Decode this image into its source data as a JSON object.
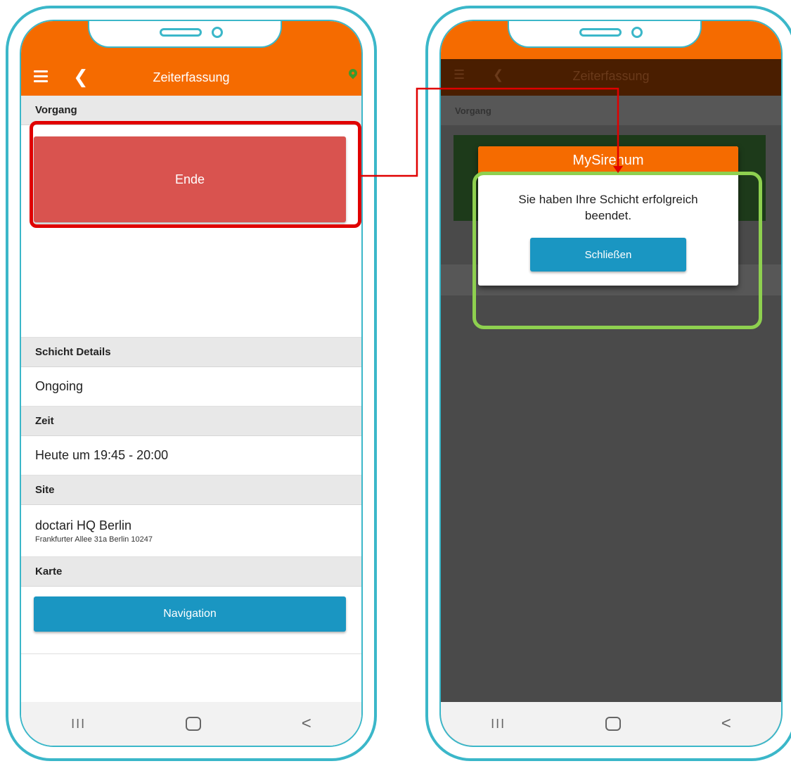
{
  "left_screen": {
    "appbar": {
      "title": "Zeiterfassung"
    },
    "vorgang": {
      "header": "Vorgang",
      "button_label": "Ende"
    },
    "schicht_details": {
      "header": "Schicht Details",
      "value": "Ongoing"
    },
    "zeit": {
      "header": "Zeit",
      "value": "Heute um 19:45 - 20:00"
    },
    "site": {
      "header": "Site",
      "name": "doctari HQ Berlin",
      "address": "Frankfurter Allee 31a Berlin 10247"
    },
    "karte": {
      "header": "Karte",
      "button_label": "Navigation"
    },
    "system_nav": {
      "recent": "III",
      "back": "<"
    }
  },
  "right_screen": {
    "appbar": {
      "title": "Zeiterfassung"
    },
    "vorgang": {
      "header": "Vorgang"
    },
    "dialog": {
      "title": "MySirenum",
      "message": "Sie haben Ihre Schicht erfolgreich beendet.",
      "button_label": "Schließen"
    },
    "system_nav": {
      "recent": "III",
      "back": "<"
    }
  },
  "colors": {
    "brand_orange": "#f56b00",
    "end_red": "#d9534f",
    "action_blue": "#1a96c2",
    "frame_teal": "#3bb7c9",
    "callout_red": "#e00000",
    "callout_green": "#8ed04f"
  }
}
